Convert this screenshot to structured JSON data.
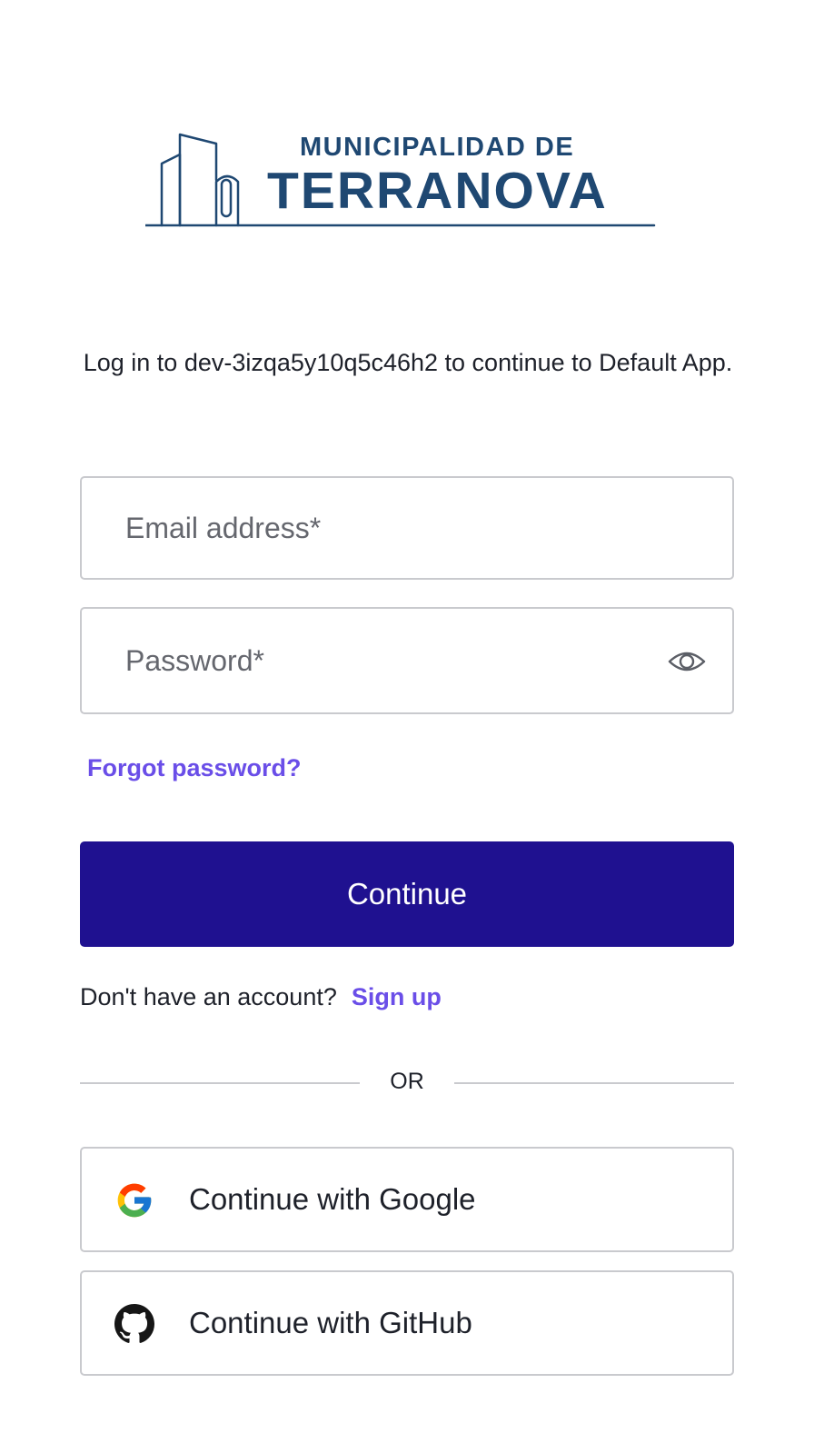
{
  "logo": {
    "line1": "MUNICIPALIDAD DE",
    "line2": "TERRANOVA",
    "icon": "building-logo-icon",
    "color": "#1f4872"
  },
  "intro": {
    "text": "Log in to dev-3izqa5y10q5c46h2 to continue to Default App."
  },
  "email": {
    "placeholder": "Email address*",
    "value": ""
  },
  "password": {
    "placeholder": "Password*",
    "value": "",
    "toggle_icon": "eye-icon"
  },
  "links": {
    "forgot": "Forgot password?",
    "signup_prompt": "Don't have an account?",
    "signup": "Sign up"
  },
  "buttons": {
    "continue": "Continue",
    "google": "Continue with Google",
    "github": "Continue with GitHub"
  },
  "divider": {
    "text": "OR"
  },
  "colors": {
    "primary": "#1f1190",
    "link": "#6a4ee8",
    "border": "#c9cace",
    "text": "#1e212a"
  }
}
